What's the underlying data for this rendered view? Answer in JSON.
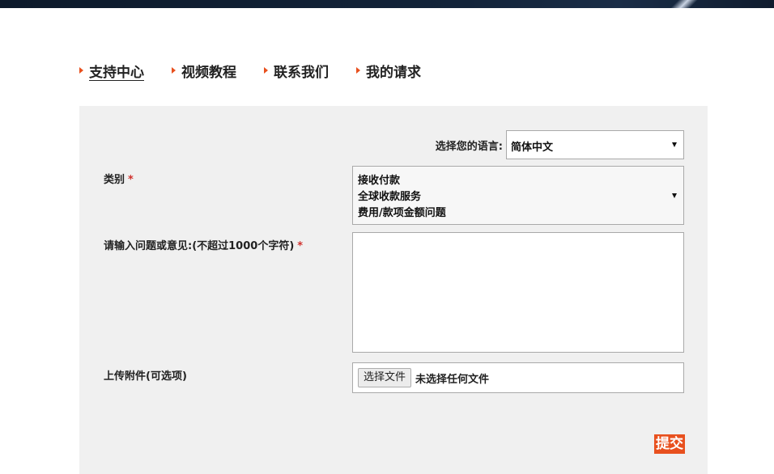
{
  "tabs": [
    {
      "label": "支持中心",
      "active": true
    },
    {
      "label": "视频教程",
      "active": false
    },
    {
      "label": "联系我们",
      "active": false
    },
    {
      "label": "我的请求",
      "active": false
    }
  ],
  "form": {
    "language_label": "选择您的语言:",
    "language_value": "简体中文",
    "category_label": "类别",
    "required_mark": "*",
    "category_options": [
      "接收付款",
      "全球收款服务",
      "费用/款项金额问题"
    ],
    "question_label": "请输入问题或意见:(不超过1000个字符)",
    "question_value": "",
    "attachment_label": "上传附件(可选项)",
    "file_button_label": "选择文件",
    "file_status": "未选择任何文件",
    "submit_label": "提交"
  },
  "colors": {
    "accent": "#e8501e",
    "panel_bg": "#f0f0f0",
    "required": "#d0312d"
  }
}
